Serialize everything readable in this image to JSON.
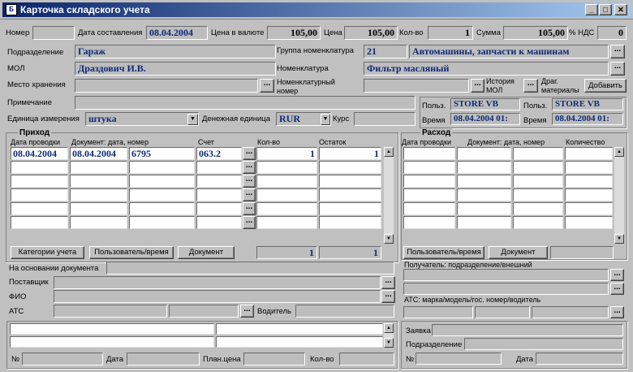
{
  "window": {
    "title": "Карточка складского учета",
    "min": "_",
    "max": "□",
    "close": "✕",
    "app_icon": "form-icon"
  },
  "row1": {
    "nomer_label": "Номер",
    "nomer": "",
    "date_label": "Дата составления",
    "date": "08.04.2004",
    "price_label": "Цена в валюте",
    "price_cur": "105,00",
    "price2_label": "Цена",
    "price": "105,00",
    "qty_label": "Кол-во",
    "qty": "1",
    "sum_label": "Сумма",
    "sum": "105,00",
    "vat_label": "% НДС",
    "vat": "0"
  },
  "info": {
    "dept_label": "Подразделение",
    "dept": "Гараж",
    "group_label": "Группа номенклатура",
    "group_code": "21",
    "group": "Автомашины, запчасти к машинам",
    "mol_label": "МОЛ",
    "mol": "Драздович И.В.",
    "nom_label": "Номенклатура",
    "nom": "Фильтр масляный",
    "place_label": "Место хранения",
    "place": "",
    "nomnum_label": "Номенклатурный номер",
    "nomnum": "",
    "history_label": "История МОЛ",
    "drag_label": "Драг. материалы",
    "add_button": "Добавить",
    "note_label": "Примечание",
    "note": "",
    "unit_label": "Единица измерения",
    "unit": "штука",
    "cur_label": "Денежная единица",
    "cur": "RUR",
    "rate_label": "Курс",
    "rate": "",
    "user_label": "Польз.",
    "user1": "STORE VB",
    "user2": "STORE VB",
    "time_label": "Время",
    "time1": "08.04.2004 01:",
    "time2": "08.04.2004 01:"
  },
  "prihod": {
    "title": "Приход",
    "headers": [
      "Дата проводки",
      "Документ: дата, номер",
      "",
      "Счет",
      "Кол-во",
      "Остаток"
    ],
    "rows": [
      [
        "08.04.2004",
        "08.04.2004",
        "6795",
        "063.2",
        "1",
        "1"
      ]
    ],
    "btn_categories": "Категории учета",
    "btn_user_time": "Пользователь/время",
    "btn_document": "Документ",
    "total_qty": "1",
    "total_rest": "1",
    "basis_label": "На основании документа",
    "supplier_label": "Поставщик",
    "fio_label": "ФИО",
    "ats_label": "АТС",
    "driver_label": "Водитель",
    "no_label": "№",
    "date_label": "Дата",
    "plan_price_label": "План.цена",
    "qty_label": "Кол-во"
  },
  "rashod": {
    "title": "Расход",
    "headers": [
      "Дата проводки",
      "Документ: дата, номер",
      "",
      "Количество"
    ],
    "btn_user_time": "Пользователь/время",
    "btn_document": "Документ",
    "recipient_label": "Получатель: подразделение/внешний",
    "ats_label": "АТС: марка/модель/гос. номер/водитель",
    "request_label": "Заявка",
    "dept_label": "Подразделение",
    "no_label": "№",
    "date_label": "Дата"
  }
}
